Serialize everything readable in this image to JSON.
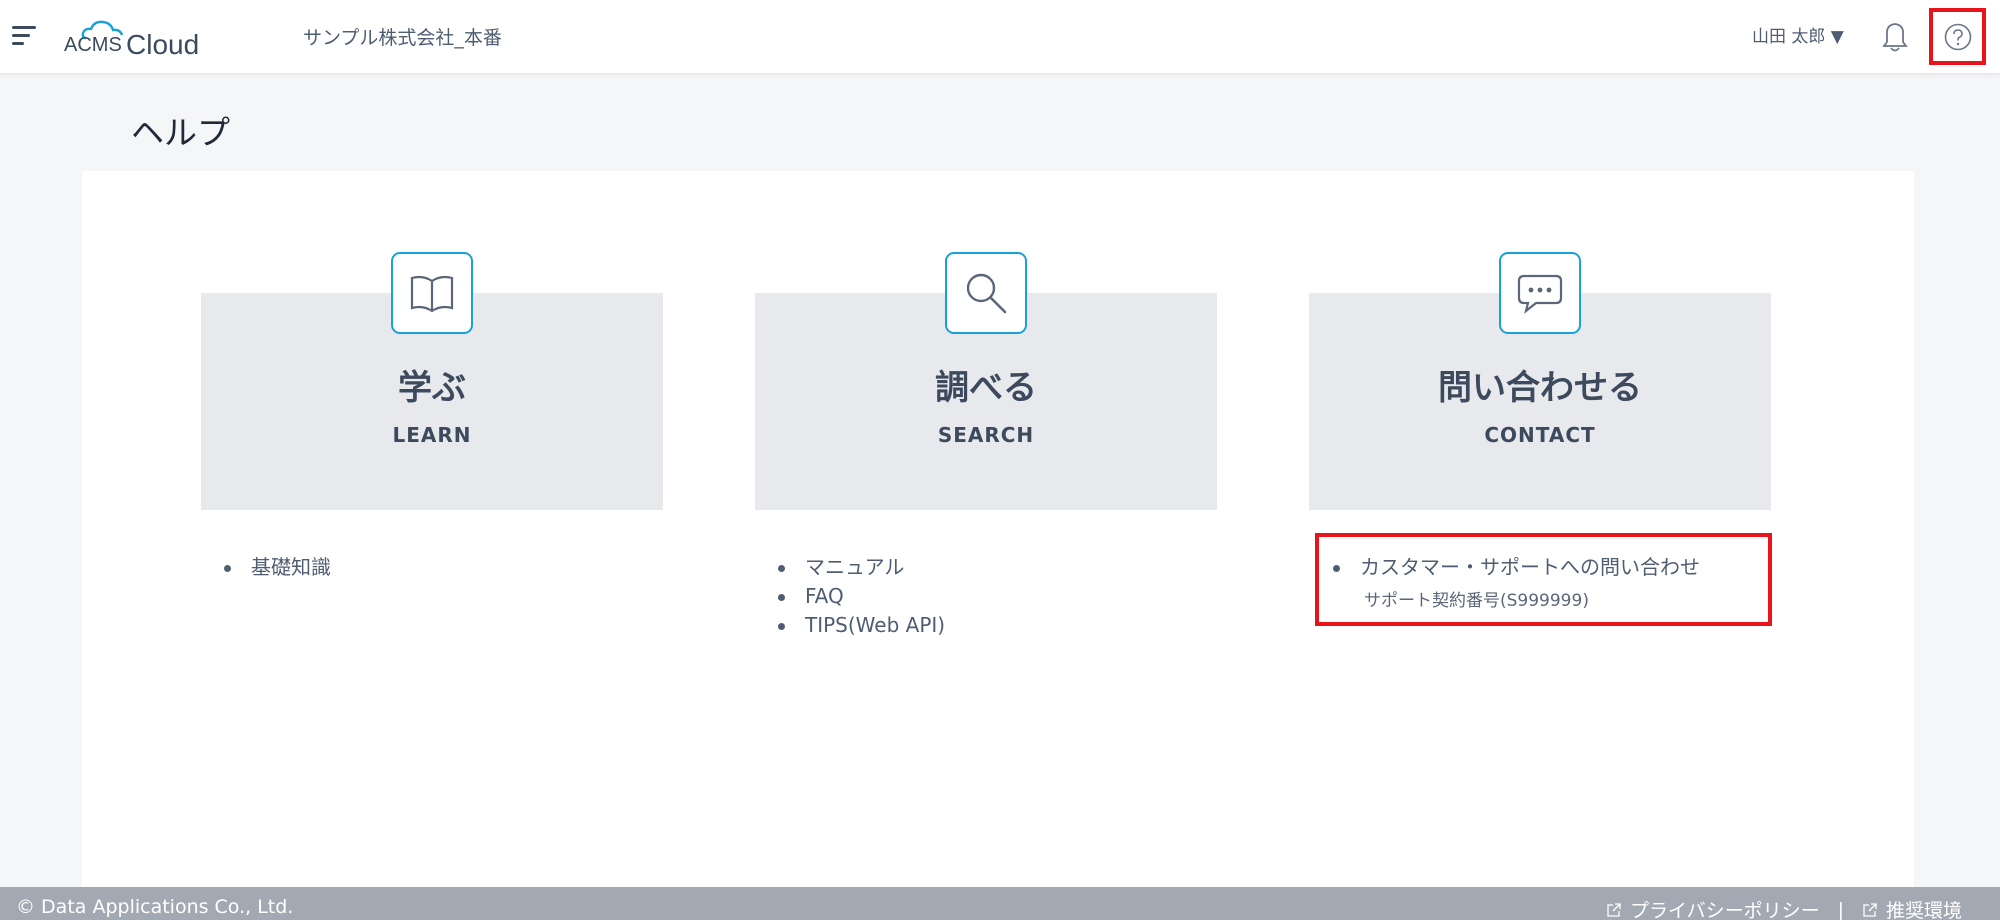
{
  "header": {
    "logo_prefix": "ACMS",
    "logo_text": "Cloud",
    "company": "サンプル株式会社_本番",
    "user": "山田 太郎 ▼"
  },
  "page": {
    "title": "ヘルプ"
  },
  "sections": [
    {
      "icon": "book-icon",
      "title": "学ぶ",
      "subtitle": "LEARN",
      "links": [
        "基礎知識"
      ]
    },
    {
      "icon": "search-icon",
      "title": "調べる",
      "subtitle": "SEARCH",
      "links": [
        "マニュアル",
        "FAQ",
        "TIPS(Web API)"
      ]
    },
    {
      "icon": "chat-bubble-icon",
      "title": "問い合わせる",
      "subtitle": "CONTACT",
      "links": [
        "カスタマー・サポートへの問い合わせ"
      ],
      "note": "サポート契約番号(S999999)"
    }
  ],
  "footer": {
    "copyright": "© Data Applications Co., Ltd.",
    "links": [
      "プライバシーポリシー",
      "推奨環境"
    ],
    "separator": "|"
  },
  "colors": {
    "accent": "#1aa2d8",
    "highlight": "#e8141c",
    "card_bg": "#e7e9ed",
    "footer_bg": "#a3a9b3"
  }
}
